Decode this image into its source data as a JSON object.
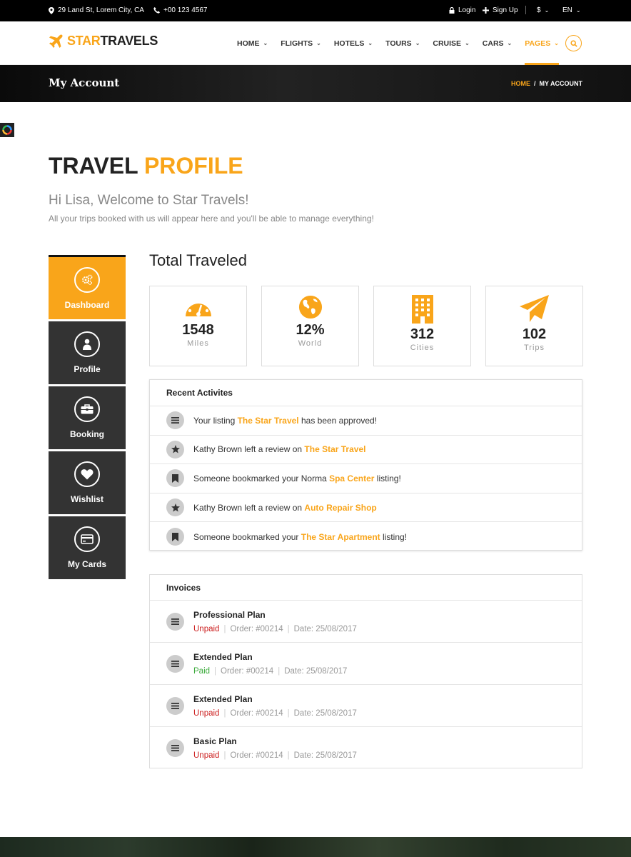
{
  "topbar": {
    "address": "29 Land St, Lorem City, CA",
    "phone": "+00 123 4567",
    "login": "Login",
    "signup": "Sign Up",
    "currency": "$",
    "language": "EN"
  },
  "brand": {
    "star": "STAR",
    "travels": "TRAVELS"
  },
  "nav": [
    {
      "label": "HOME"
    },
    {
      "label": "FLIGHTS"
    },
    {
      "label": "HOTELS"
    },
    {
      "label": "TOURS"
    },
    {
      "label": "CRUISE"
    },
    {
      "label": "CARS"
    },
    {
      "label": "PAGES"
    }
  ],
  "banner": {
    "title": "My Account",
    "breadcrumb_home": "HOME",
    "breadcrumb_sep": "/",
    "breadcrumb_current": "MY ACCOUNT"
  },
  "profile": {
    "title_dark": "TRAVEL",
    "title_accent": "PROFILE",
    "welcome": "Hi Lisa, Welcome to Star Travels!",
    "subtext": "All your trips booked with us will appear here and you'll be able to manage everything!"
  },
  "sidebar": [
    {
      "label": "Dashboard",
      "icon": "gears-icon"
    },
    {
      "label": "Profile",
      "icon": "user-icon"
    },
    {
      "label": "Booking",
      "icon": "briefcase-icon"
    },
    {
      "label": "Wishlist",
      "icon": "heart-icon"
    },
    {
      "label": "My Cards",
      "icon": "credit-card-icon"
    }
  ],
  "total_traveled": {
    "title": "Total Traveled",
    "stats": [
      {
        "value": "1548",
        "caption": "Miles",
        "icon": "speedometer-icon"
      },
      {
        "value": "12%",
        "caption": "World",
        "icon": "globe-icon"
      },
      {
        "value": "312",
        "caption": "Cities",
        "icon": "building-icon"
      },
      {
        "value": "102",
        "caption": "Trips",
        "icon": "paper-plane-icon"
      }
    ]
  },
  "recent": {
    "title": "Recent Activites",
    "items": [
      {
        "icon": "list-icon",
        "pre": "Your listing ",
        "highlight": "The Star Travel",
        "post": " has been approved!"
      },
      {
        "icon": "star-icon",
        "pre": "Kathy Brown left a review on ",
        "highlight": "The Star Travel",
        "post": ""
      },
      {
        "icon": "bookmark-icon",
        "pre": "Someone bookmarked your Norma ",
        "highlight": "Spa Center",
        "post": " listing!"
      },
      {
        "icon": "star-icon",
        "pre": "Kathy Brown left a review on ",
        "highlight": "Auto Repair Shop",
        "post": ""
      },
      {
        "icon": "bookmark-icon",
        "pre": "Someone bookmarked your ",
        "highlight": "The Star Apartment",
        "post": " listing!"
      }
    ]
  },
  "invoices": {
    "title": "Invoices",
    "items": [
      {
        "name": "Professional Plan",
        "status": "Unpaid",
        "order": "Order: #00214",
        "date": "Date: 25/08/2017"
      },
      {
        "name": "Extended Plan",
        "status": "Paid",
        "order": "Order: #00214",
        "date": "Date: 25/08/2017"
      },
      {
        "name": "Extended Plan",
        "status": "Unpaid",
        "order": "Order: #00214",
        "date": "Date: 25/08/2017"
      },
      {
        "name": "Basic Plan",
        "status": "Unpaid",
        "order": "Order: #00214",
        "date": "Date: 25/08/2017"
      }
    ]
  },
  "colors": {
    "accent": "#f9a51a",
    "dark": "#333333",
    "unpaid": "#cc1f1f",
    "paid": "#3cab3c"
  }
}
